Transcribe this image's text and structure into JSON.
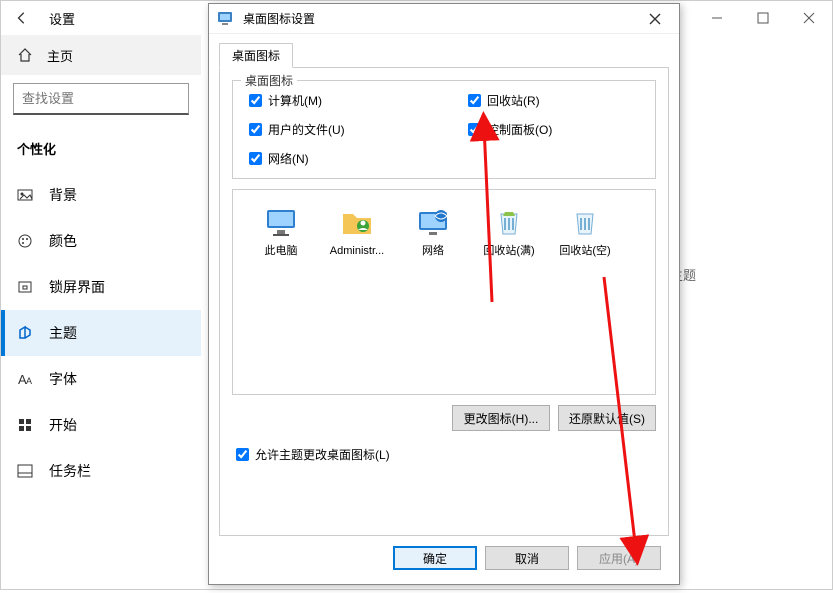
{
  "settings": {
    "title": "设置",
    "home_label": "主页",
    "search_placeholder": "查找设置",
    "section_title": "个性化",
    "nav": [
      {
        "key": "background",
        "label": "背景"
      },
      {
        "key": "colors",
        "label": "颜色"
      },
      {
        "key": "lockscreen",
        "label": "锁屏界面"
      },
      {
        "key": "themes",
        "label": "主题",
        "selected": true
      },
      {
        "key": "fonts",
        "label": "字体"
      },
      {
        "key": "start",
        "label": "开始"
      },
      {
        "key": "taskbar",
        "label": "任务栏"
      }
    ],
    "content_hint": "主题"
  },
  "dialog": {
    "title": "桌面图标设置",
    "tab_label": "桌面图标",
    "group_label": "桌面图标",
    "checkboxes": [
      {
        "key": "computer",
        "label": "计算机(M)",
        "checked": true
      },
      {
        "key": "recycle",
        "label": "回收站(R)",
        "checked": true
      },
      {
        "key": "userfiles",
        "label": "用户的文件(U)",
        "checked": true
      },
      {
        "key": "controlpanel",
        "label": "控制面板(O)",
        "checked": true
      },
      {
        "key": "network",
        "label": "网络(N)",
        "checked": true
      }
    ],
    "preview": [
      {
        "key": "thispc",
        "label": "此电脑",
        "icon": "monitor"
      },
      {
        "key": "admin",
        "label": "Administr...",
        "icon": "folder-user"
      },
      {
        "key": "network",
        "label": "网络",
        "icon": "globe-monitor"
      },
      {
        "key": "recycle-full",
        "label": "回收站(满)",
        "icon": "bin-full"
      },
      {
        "key": "recycle-empty",
        "label": "回收站(空)",
        "icon": "bin-empty"
      }
    ],
    "change_icon_btn": "更改图标(H)...",
    "restore_btn": "还原默认值(S)",
    "allow_theme_label": "允许主题更改桌面图标(L)",
    "allow_theme_checked": true,
    "ok_btn": "确定",
    "cancel_btn": "取消",
    "apply_btn": "应用(A)"
  }
}
